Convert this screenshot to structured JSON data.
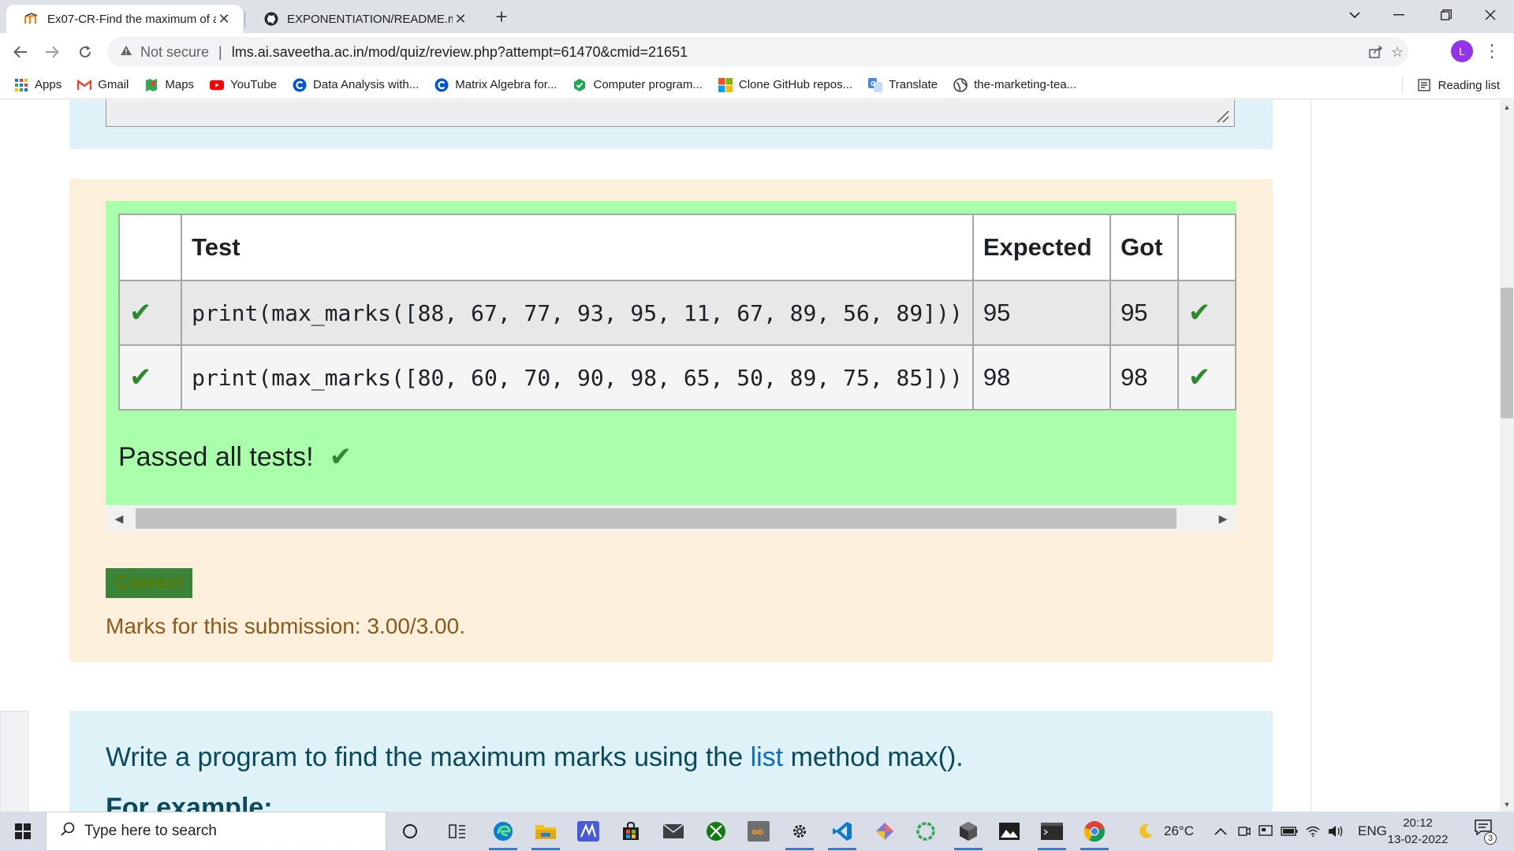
{
  "browser": {
    "tabs": [
      {
        "title": "Ex07-CR-Find the maximum of a",
        "favicon": "moodle-icon"
      },
      {
        "title": "EXPONENTIATION/README.md",
        "favicon": "github-icon"
      }
    ],
    "new_tab": "+",
    "omnibox": {
      "security_label": "Not secure",
      "url": "lms.ai.saveetha.ac.in/mod/quiz/review.php?attempt=61470&cmid=21651"
    },
    "profile_initial": "L",
    "bookmarks": [
      {
        "label": "Apps",
        "icon": "apps-grid-icon"
      },
      {
        "label": "Gmail",
        "icon": "gmail-icon"
      },
      {
        "label": "Maps",
        "icon": "maps-icon"
      },
      {
        "label": "YouTube",
        "icon": "youtube-icon"
      },
      {
        "label": "Data Analysis with...",
        "icon": "coursera-icon"
      },
      {
        "label": "Matrix Algebra for...",
        "icon": "coursera-icon"
      },
      {
        "label": "Computer program...",
        "icon": "shield-icon"
      },
      {
        "label": "Clone GitHub repos...",
        "icon": "microsoft-icon"
      },
      {
        "label": "Translate",
        "icon": "translate-icon"
      },
      {
        "label": "the-marketing-tea...",
        "icon": "globe-icon"
      }
    ],
    "reading_list": "Reading list"
  },
  "results": {
    "headers": [
      "",
      "Test",
      "Expected",
      "Got",
      ""
    ],
    "rows": [
      {
        "test": "print(max_marks([88, 67, 77, 93, 95, 11, 67, 89, 56, 89]))",
        "expected": "95",
        "got": "95"
      },
      {
        "test": "print(max_marks([80, 60, 70, 90, 98, 65, 50, 89, 75, 85]))",
        "expected": "98",
        "got": "98"
      }
    ],
    "passed_message": "Passed all tests!"
  },
  "outcome": {
    "badge": "Correct",
    "marks": "Marks for this submission: 3.00/3.00."
  },
  "question": {
    "prefix": "Write a program to find the maximum marks using the ",
    "link": "list",
    "suffix": " method max().",
    "for_example": "For example:"
  },
  "taskbar": {
    "search_placeholder": "Type here to search",
    "weather": "26°C",
    "language": "ENG",
    "time": "20:12",
    "date": "13-02-2022",
    "notification_count": "3"
  },
  "colors": {
    "pass_green": "#aaffaa",
    "tick_green": "#2f8a2f",
    "outcome_bg": "#fcefdc",
    "question_bg": "#def2f8",
    "correct_badge": "#398439"
  }
}
